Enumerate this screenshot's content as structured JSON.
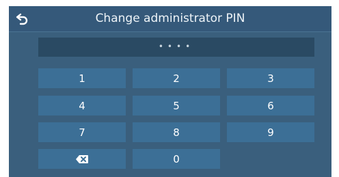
{
  "header": {
    "title": "Change administrator PIN",
    "back_icon": "back-arrow-icon"
  },
  "pin": {
    "masked_value": "••••"
  },
  "keypad": {
    "k1": "1",
    "k2": "2",
    "k3": "3",
    "k4": "4",
    "k5": "5",
    "k6": "6",
    "k7": "7",
    "k8": "8",
    "k9": "9",
    "k0": "0",
    "backspace_icon": "backspace-icon"
  },
  "colors": {
    "screen_bg": "#3a5f7d",
    "key_bg": "#3c6f96",
    "field_bg": "#2a4a63"
  }
}
